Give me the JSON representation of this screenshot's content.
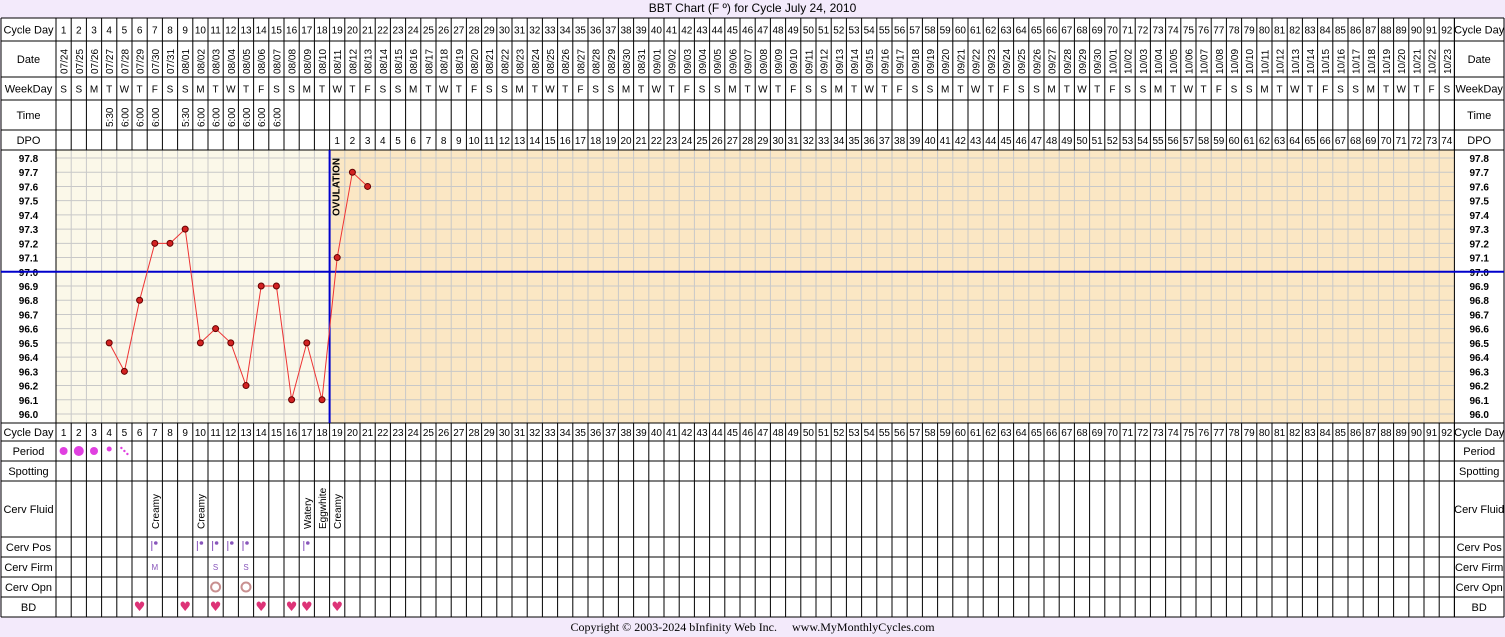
{
  "title": "BBT Chart (F º) for Cycle July 24, 2010",
  "footer": {
    "copyright": "Copyright © 2003-2024 bInfinity Web Inc.",
    "site": "www.MyMonthlyCycles.com"
  },
  "rows": {
    "cycle_day": "Cycle Day",
    "date": "Date",
    "weekday": "WeekDay",
    "time": "Time",
    "dpo": "DPO",
    "period": "Period",
    "spotting": "Spotting",
    "cerv_fluid": "Cerv Fluid",
    "cerv_pos": "Cerv Pos",
    "cerv_firm": "Cerv Firm",
    "cerv_opn": "Cerv Opn",
    "bd": "BD"
  },
  "colors": {
    "page_bg": "#f3eafb",
    "chart_bg_pre": "#fbf8e9",
    "chart_bg_post": "#fbe7c4",
    "grid": "#c8c8c8",
    "line": "#ee3333",
    "point": "#d22222",
    "ovulation": "#0000cc",
    "coverline": "#0000cc",
    "period": "#e040e0",
    "bd_heart": "#dd3377",
    "cerv": "#8855bb"
  },
  "chart_data": {
    "type": "line",
    "title": "BBT Chart (F º) for Cycle July 24, 2010",
    "cycle_days": [
      1,
      2,
      3,
      4,
      5,
      6,
      7,
      8,
      9,
      10,
      11,
      12,
      13,
      14,
      15,
      16,
      17,
      18,
      19,
      20,
      21,
      22,
      23,
      24,
      25,
      26,
      27,
      28,
      29,
      30,
      31,
      32,
      33,
      34,
      35,
      36,
      37,
      38,
      39,
      40,
      41,
      42,
      43,
      44,
      45,
      46,
      47,
      48,
      49,
      50,
      51,
      52,
      53,
      54,
      55,
      56,
      57,
      58,
      59,
      60,
      61,
      62,
      63,
      64,
      65,
      66,
      67,
      68,
      69,
      70,
      71,
      72,
      73,
      74,
      75,
      76,
      77,
      78,
      79,
      80,
      81,
      82,
      83,
      84,
      85,
      86,
      87,
      88,
      89,
      90,
      91,
      92
    ],
    "dates": [
      "07/24",
      "07/25",
      "07/26",
      "07/27",
      "07/28",
      "07/29",
      "07/30",
      "07/31",
      "08/01",
      "08/02",
      "08/03",
      "08/04",
      "08/05",
      "08/06",
      "08/07",
      "08/08",
      "08/09",
      "08/10",
      "08/11",
      "08/12",
      "08/13",
      "08/14",
      "08/15",
      "08/16",
      "08/17",
      "08/18",
      "08/19",
      "08/20",
      "08/21",
      "08/22",
      "08/23",
      "08/24",
      "08/25",
      "08/26",
      "08/27",
      "08/28",
      "08/29",
      "08/30",
      "08/31",
      "09/01",
      "09/02",
      "09/03",
      "09/04",
      "09/05",
      "09/06",
      "09/07",
      "09/08",
      "09/09",
      "09/10",
      "09/11",
      "09/12",
      "09/13",
      "09/14",
      "09/15",
      "09/16",
      "09/17",
      "09/18",
      "09/19",
      "09/20",
      "09/21",
      "09/22",
      "09/23",
      "09/24",
      "09/25",
      "09/26",
      "09/27",
      "09/28",
      "09/29",
      "09/30",
      "10/01",
      "10/02",
      "10/03",
      "10/04",
      "10/05",
      "10/06",
      "10/07",
      "10/08",
      "10/09",
      "10/10",
      "10/11",
      "10/12",
      "10/13",
      "10/14",
      "10/15",
      "10/16",
      "10/17",
      "10/18",
      "10/19",
      "10/20",
      "10/21",
      "10/22",
      "10/23"
    ],
    "weekdays": [
      "S",
      "S",
      "M",
      "T",
      "W",
      "T",
      "F",
      "S",
      "S",
      "M",
      "T",
      "W",
      "T",
      "F",
      "S",
      "S",
      "M",
      "T",
      "W",
      "T",
      "F",
      "S",
      "S",
      "M",
      "T",
      "W",
      "T",
      "F",
      "S",
      "S",
      "M",
      "T",
      "W",
      "T",
      "F",
      "S",
      "S",
      "M",
      "T",
      "W",
      "T",
      "F",
      "S",
      "S",
      "M",
      "T",
      "W",
      "T",
      "F",
      "S",
      "S",
      "M",
      "T",
      "W",
      "T",
      "F",
      "S",
      "S",
      "M",
      "T",
      "W",
      "T",
      "F",
      "S",
      "S",
      "M",
      "T",
      "W",
      "T",
      "F",
      "S",
      "S",
      "M",
      "T",
      "W",
      "T",
      "F",
      "S",
      "S",
      "M",
      "T",
      "W",
      "T",
      "F",
      "S",
      "S",
      "M",
      "T",
      "W",
      "T",
      "F",
      "S"
    ],
    "times": {
      "4": "5:30",
      "5": "6:00",
      "6": "6:00",
      "7": "6:00",
      "9": "5:30",
      "10": "6:00",
      "11": "6:00",
      "12": "6:00",
      "13": "6:00",
      "14": "6:00",
      "15": "6:00"
    },
    "dpo": [
      1,
      2,
      3,
      4,
      5,
      6,
      7,
      8,
      9,
      10,
      11,
      12,
      13,
      14,
      15,
      16,
      17,
      18,
      19,
      20,
      21,
      22,
      23,
      24,
      25,
      26,
      27,
      28,
      29,
      30,
      31,
      32,
      33,
      34,
      35,
      36,
      37,
      38,
      39,
      40,
      41,
      42,
      43,
      44,
      45,
      46,
      47,
      48,
      49,
      50,
      51,
      52,
      53,
      54,
      55,
      56,
      57,
      58,
      59,
      60,
      61,
      62,
      63,
      64,
      65,
      66,
      67,
      68,
      69,
      70,
      71,
      72,
      73,
      74
    ],
    "dpo_start_day": 19,
    "y_ticks": [
      "97.8",
      "97.7",
      "97.6",
      "97.5",
      "97.4",
      "97.3",
      "97.2",
      "97.1",
      "97.0",
      "96.9",
      "96.8",
      "96.7",
      "96.6",
      "96.5",
      "96.4",
      "96.3",
      "96.2",
      "96.1",
      "96.0"
    ],
    "ylim": [
      96.0,
      97.8
    ],
    "temps": [
      {
        "day": 4,
        "temp": 96.5
      },
      {
        "day": 5,
        "temp": 96.3
      },
      {
        "day": 6,
        "temp": 96.8
      },
      {
        "day": 7,
        "temp": 97.2
      },
      {
        "day": 8,
        "temp": 97.2
      },
      {
        "day": 9,
        "temp": 97.3
      },
      {
        "day": 10,
        "temp": 96.5
      },
      {
        "day": 11,
        "temp": 96.6
      },
      {
        "day": 12,
        "temp": 96.5
      },
      {
        "day": 13,
        "temp": 96.2
      },
      {
        "day": 14,
        "temp": 96.9
      },
      {
        "day": 15,
        "temp": 96.9
      },
      {
        "day": 16,
        "temp": 96.1
      },
      {
        "day": 17,
        "temp": 96.5
      },
      {
        "day": 18,
        "temp": 96.1
      },
      {
        "day": 19,
        "temp": 97.1
      },
      {
        "day": 20,
        "temp": 97.7
      },
      {
        "day": 21,
        "temp": 97.6
      }
    ],
    "coverline": 97.0,
    "ovulation_day": 18,
    "ovulation_label": "OVULATION",
    "period": [
      {
        "day": 1,
        "size": "medium"
      },
      {
        "day": 2,
        "size": "heavy"
      },
      {
        "day": 3,
        "size": "medium"
      },
      {
        "day": 4,
        "size": "light"
      },
      {
        "day": 5,
        "size": "spotting"
      }
    ],
    "cerv_fluid": [
      {
        "day": 7,
        "label": "Creamy"
      },
      {
        "day": 10,
        "label": "Creamy"
      },
      {
        "day": 17,
        "label": "Watery"
      },
      {
        "day": 18,
        "label": "Eggwhite"
      },
      {
        "day": 19,
        "label": "Creamy"
      }
    ],
    "cerv_pos_days": [
      7,
      10,
      11,
      12,
      13,
      17
    ],
    "cerv_firm": [
      {
        "day": 7,
        "label": "M"
      },
      {
        "day": 11,
        "label": "S"
      },
      {
        "day": 13,
        "label": "S"
      }
    ],
    "cerv_opn_days": [
      11,
      13
    ],
    "bd_days": [
      6,
      9,
      11,
      14,
      16,
      17,
      19
    ]
  }
}
